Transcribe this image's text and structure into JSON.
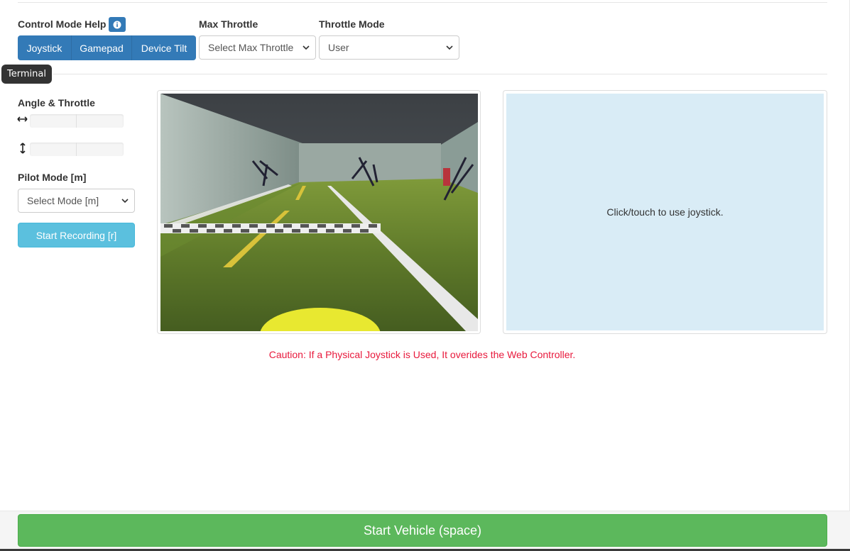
{
  "controls": {
    "control_mode_label": "Control Mode Help",
    "help_icon": "info-icon",
    "modes": [
      "Joystick",
      "Gamepad",
      "Device Tilt"
    ],
    "max_throttle_label": "Max Throttle",
    "max_throttle_value": "Select Max Throttle",
    "throttle_mode_label": "Throttle Mode",
    "throttle_mode_value": "User"
  },
  "tooltip": "Terminal",
  "sidebar": {
    "angle_throttle_label": "Angle & Throttle",
    "angle_icon": "horizontal-arrow-icon",
    "throttle_icon": "vertical-arrow-icon",
    "angle_value": 0,
    "throttle_value": 0,
    "pilot_mode_label": "Pilot Mode [m]",
    "pilot_mode_value": "Select Mode [m]",
    "record_button": "Start Recording [r]"
  },
  "joystick_pad": {
    "text": "Click/touch to use joystick."
  },
  "caution": "Caution: If a Physical Joystick is Used, It overides the Web Controller.",
  "footer": {
    "start_button": "Start Vehicle (space)"
  },
  "colors": {
    "primary": "#337ab7",
    "info": "#5bc0de",
    "success": "#5cb85c",
    "danger": "#e8193c",
    "joystick_bg": "#d9ecf6"
  }
}
